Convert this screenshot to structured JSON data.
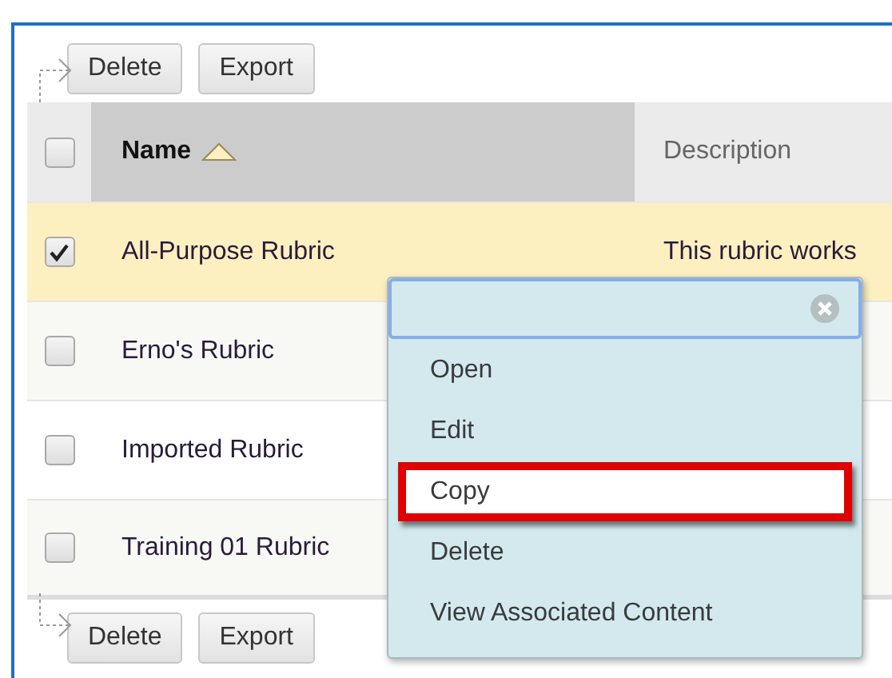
{
  "top_toolbar": {
    "buttons": [
      "Delete",
      "Export"
    ]
  },
  "table": {
    "columns": [
      {
        "label": "Name",
        "sorted": true
      },
      {
        "label": "Description",
        "sorted": false
      }
    ],
    "header_checkbox": {
      "checked": false
    },
    "rows": [
      {
        "name": "All-Purpose Rubric",
        "description": "This rubric works",
        "checked": true
      },
      {
        "name": "Erno's Rubric",
        "description": "",
        "checked": false
      },
      {
        "name": "Imported Rubric",
        "description": "",
        "checked": false
      },
      {
        "name": "Training 01 Rubric",
        "description": "",
        "checked": false
      }
    ]
  },
  "context_menu": {
    "items": [
      {
        "label": "Open",
        "selected": false
      },
      {
        "label": "Edit",
        "selected": false
      },
      {
        "label": "Copy",
        "selected": true
      },
      {
        "label": "Delete",
        "selected": false
      },
      {
        "label": "View Associated Content",
        "selected": false
      }
    ]
  },
  "bottom_toolbar": {
    "buttons": [
      "Delete",
      "Export"
    ]
  }
}
